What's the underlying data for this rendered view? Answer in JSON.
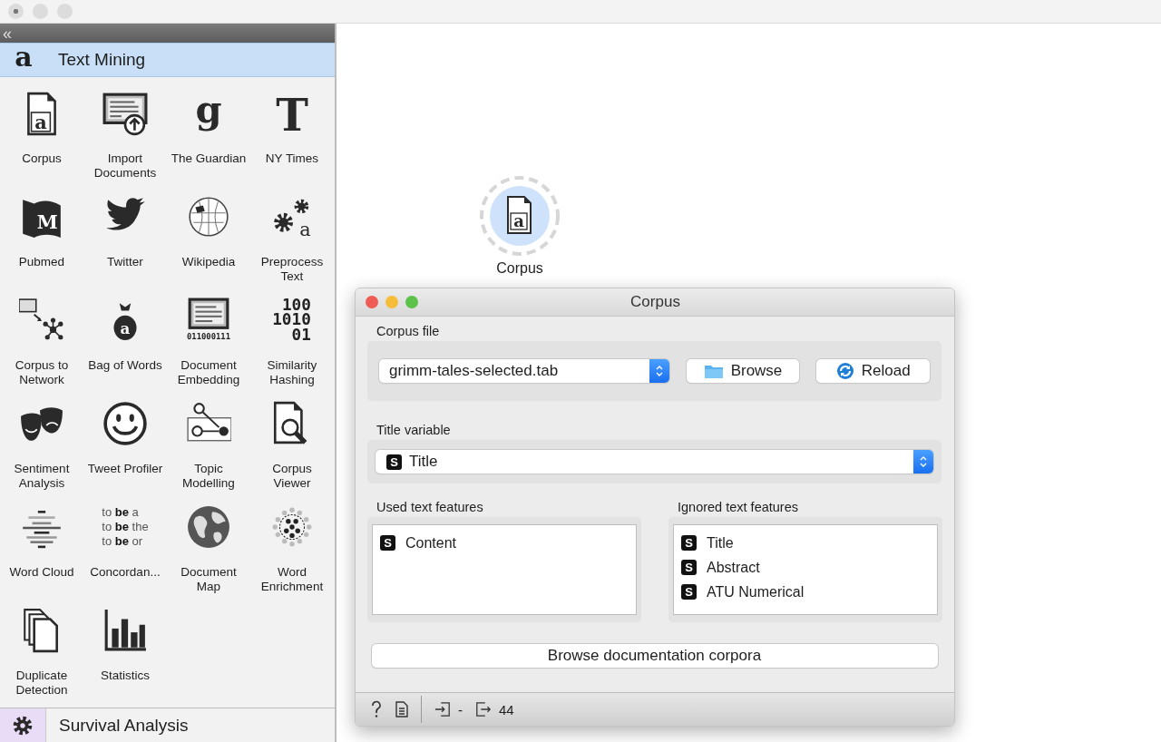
{
  "sidebar": {
    "collapse_glyph": "«",
    "category": {
      "title": "Text Mining",
      "glyph": "a"
    },
    "widgets": [
      {
        "label": "Corpus",
        "glyph": "a"
      },
      {
        "label": "Import Documents"
      },
      {
        "label": "The Guardian",
        "glyph": "g"
      },
      {
        "label": "NY Times",
        "glyph": "T"
      },
      {
        "label": "Pubmed",
        "glyph": "M"
      },
      {
        "label": "Twitter"
      },
      {
        "label": "Wikipedia"
      },
      {
        "label": "Preprocess Text",
        "glyph": "a"
      },
      {
        "label": "Corpus to Network"
      },
      {
        "label": "Bag of Words",
        "glyph": "a"
      },
      {
        "label": "Document Embedding",
        "icon_lines": [
          "011000111"
        ]
      },
      {
        "label": "Similarity Hashing",
        "icon_lines": [
          "100",
          "1010",
          "01"
        ]
      },
      {
        "label": "Sentiment Analysis"
      },
      {
        "label": "Tweet Profiler"
      },
      {
        "label": "Topic Modelling"
      },
      {
        "label": "Corpus Viewer"
      },
      {
        "label": "Word Cloud"
      },
      {
        "label": "Concordan...",
        "icon_lines": [
          "to **be** a",
          "to **be** the",
          "to **be** or"
        ]
      },
      {
        "label": "Document Map"
      },
      {
        "label": "Word Enrichment"
      },
      {
        "label": "Duplicate Detection"
      },
      {
        "label": "Statistics"
      }
    ],
    "next_category": {
      "title": "Survival Analysis"
    }
  },
  "canvas": {
    "node": {
      "label": "Corpus",
      "glyph": "a"
    }
  },
  "dialog": {
    "title": "Corpus",
    "corpus_file": {
      "label": "Corpus file",
      "value": "grimm-tales-selected.tab",
      "buttons": [
        "Browse",
        "Reload"
      ]
    },
    "title_variable": {
      "label": "Title variable",
      "badge": "S",
      "value": "Title"
    },
    "used": {
      "label": "Used text features",
      "items": [
        {
          "badge": "S",
          "name": "Content"
        }
      ]
    },
    "ignored": {
      "label": "Ignored text features",
      "items": [
        {
          "badge": "S",
          "name": "Title"
        },
        {
          "badge": "S",
          "name": "Abstract"
        },
        {
          "badge": "S",
          "name": "ATU Numerical"
        }
      ]
    },
    "doc_button": "Browse documentation corpora",
    "status": {
      "input": "-",
      "output": "44"
    }
  }
}
